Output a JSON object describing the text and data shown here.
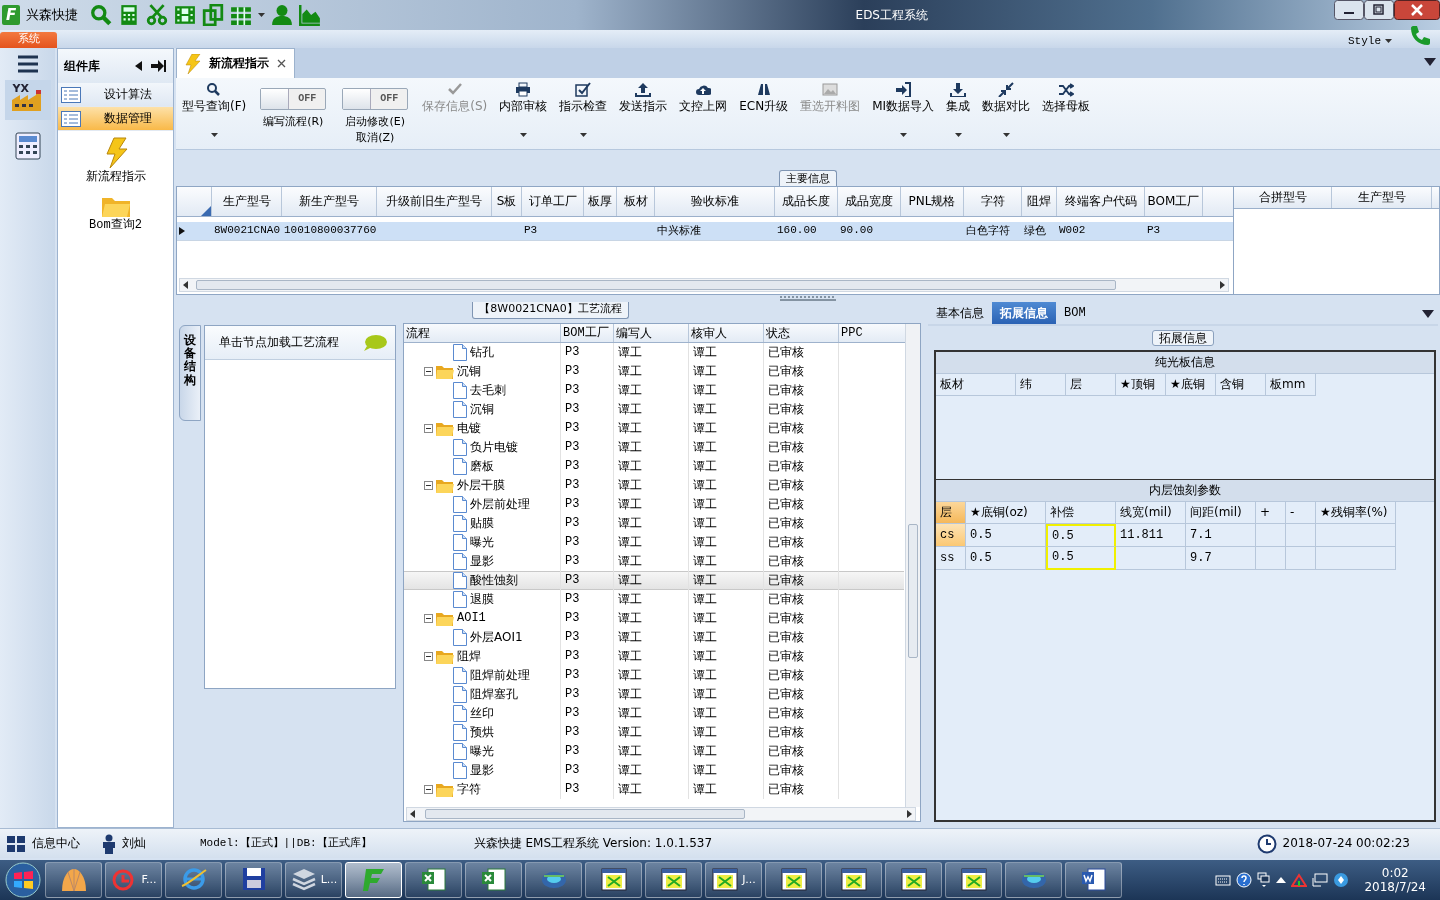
{
  "title_bar": {
    "logo": "F",
    "app_name": "兴森快捷",
    "title": "EDS工程系统"
  },
  "ribbon": {
    "tab": "系统",
    "style_menu": "Style"
  },
  "rail_items": [
    {
      "kind": "factory",
      "label": "YX",
      "selected": true
    },
    {
      "kind": "calculator",
      "selected": false
    }
  ],
  "component_panel": {
    "title": "组件库",
    "items": [
      {
        "label": "设计算法",
        "selected": false
      },
      {
        "label": "数据管理",
        "selected": true
      }
    ],
    "tools": [
      {
        "label": "新流程指示"
      },
      {
        "label": "Bom查询2"
      }
    ]
  },
  "document_tab": {
    "label": "新流程指示"
  },
  "toolbar": [
    {
      "kind": "button",
      "label": "型号查询(F)",
      "disabled": false,
      "dropdown": true
    },
    {
      "kind": "toggle",
      "toggle_text": "OFF",
      "on": false,
      "lines": [
        "编写流程(R)"
      ]
    },
    {
      "kind": "toggle",
      "toggle_text": "OFF",
      "on": false,
      "lines": [
        "启动修改(E)",
        "取消(Z)"
      ]
    },
    {
      "kind": "button",
      "label": "保存信息(S)",
      "disabled": true,
      "dropdown": false
    },
    {
      "kind": "button",
      "label": "内部审核",
      "disabled": false,
      "dropdown": true
    },
    {
      "kind": "button",
      "label": "指示检查",
      "disabled": false,
      "dropdown": true
    },
    {
      "kind": "button",
      "label": "发送指示",
      "disabled": false,
      "dropdown": false
    },
    {
      "kind": "button",
      "label": "文控上网",
      "disabled": false,
      "dropdown": false
    },
    {
      "kind": "button",
      "label": "ECN升级",
      "disabled": false,
      "dropdown": false
    },
    {
      "kind": "button",
      "label": "重选开料图",
      "disabled": true,
      "dropdown": false
    },
    {
      "kind": "button",
      "label": "MI数据导入",
      "disabled": false,
      "dropdown": true
    },
    {
      "kind": "button",
      "label": "集成",
      "disabled": false,
      "dropdown": true
    },
    {
      "kind": "button",
      "label": "数据对比",
      "disabled": false,
      "dropdown": true
    },
    {
      "kind": "button",
      "label": "选择母板",
      "disabled": false,
      "dropdown": false
    }
  ],
  "main_info": {
    "title": "主要信息",
    "columns": [
      "生产型号",
      "新生产型号",
      "升级前旧生产型号",
      "S板",
      "订单工厂",
      "板厚",
      "板材",
      "验收标准",
      "成品长度",
      "成品宽度",
      "PNL规格",
      "字符",
      "阻焊",
      "终端客户代码",
      "BOM工厂"
    ],
    "rows": [
      {
        "selected": true,
        "cells": [
          "8W0021CNA0",
          "10010800037760",
          null,
          null,
          "P3",
          null,
          null,
          "中兴标准",
          "160.00",
          "90.00",
          null,
          "白色字符",
          "绿色",
          "W002",
          "P3"
        ]
      }
    ],
    "side_columns": [
      "合拼型号",
      "生产型号"
    ]
  },
  "process": {
    "title": "【8W0021CNA0】工艺流程",
    "side_tab": "设备结构",
    "hint": "单击节点加载工艺流程",
    "columns": [
      "流程",
      "BOM工厂",
      "编写人",
      "核审人",
      "状态",
      "PPC"
    ],
    "tree": [
      {
        "children": [
          {
            "kind": "step",
            "label": "钻孔",
            "selected": false,
            "bom_factory": "P3",
            "writer": "谭工",
            "reviewer": "谭工",
            "status": "已审核"
          }
        ]
      },
      {
        "kind": "folder",
        "label": "沉铜",
        "expanded": true,
        "selected": false,
        "bom_factory": "P3",
        "writer": "谭工",
        "reviewer": "谭工",
        "status": "已审核",
        "children": [
          {
            "kind": "step",
            "label": "去毛刺",
            "selected": false,
            "bom_factory": "P3",
            "writer": "谭工",
            "reviewer": "谭工",
            "status": "已审核"
          },
          {
            "kind": "step",
            "label": "沉铜",
            "selected": false,
            "bom_factory": "P3",
            "writer": "谭工",
            "reviewer": "谭工",
            "status": "已审核"
          }
        ]
      },
      {
        "kind": "folder",
        "label": "电镀",
        "expanded": true,
        "selected": false,
        "bom_factory": "P3",
        "writer": "谭工",
        "reviewer": "谭工",
        "status": "已审核",
        "children": [
          {
            "kind": "step",
            "label": "负片电镀",
            "selected": false,
            "bom_factory": "P3",
            "writer": "谭工",
            "reviewer": "谭工",
            "status": "已审核"
          },
          {
            "kind": "step",
            "label": "磨板",
            "selected": false,
            "bom_factory": "P3",
            "writer": "谭工",
            "reviewer": "谭工",
            "status": "已审核"
          }
        ]
      },
      {
        "kind": "folder",
        "label": "外层干膜",
        "expanded": true,
        "selected": false,
        "bom_factory": "P3",
        "writer": "谭工",
        "reviewer": "谭工",
        "status": "已审核",
        "children": [
          {
            "kind": "step",
            "label": "外层前处理",
            "selected": false,
            "bom_factory": "P3",
            "writer": "谭工",
            "reviewer": "谭工",
            "status": "已审核"
          },
          {
            "kind": "step",
            "label": "贴膜",
            "selected": false,
            "bom_factory": "P3",
            "writer": "谭工",
            "reviewer": "谭工",
            "status": "已审核"
          },
          {
            "kind": "step",
            "label": "曝光",
            "selected": false,
            "bom_factory": "P3",
            "writer": "谭工",
            "reviewer": "谭工",
            "status": "已审核"
          },
          {
            "kind": "step",
            "label": "显影",
            "selected": false,
            "bom_factory": "P3",
            "writer": "谭工",
            "reviewer": "谭工",
            "status": "已审核"
          },
          {
            "kind": "step",
            "label": "酸性蚀刻",
            "selected": true,
            "bom_factory": "P3",
            "writer": "谭工",
            "reviewer": "谭工",
            "status": "已审核"
          },
          {
            "kind": "step",
            "label": "退膜",
            "selected": false,
            "bom_factory": "P3",
            "writer": "谭工",
            "reviewer": "谭工",
            "status": "已审核"
          }
        ]
      },
      {
        "kind": "folder",
        "label": "AOI1",
        "expanded": true,
        "selected": false,
        "bom_factory": "P3",
        "writer": "谭工",
        "reviewer": "谭工",
        "status": "已审核",
        "children": [
          {
            "kind": "step",
            "label": "外层AOI1",
            "selected": false,
            "bom_factory": "P3",
            "writer": "谭工",
            "reviewer": "谭工",
            "status": "已审核"
          }
        ]
      },
      {
        "kind": "folder",
        "label": "阻焊",
        "expanded": true,
        "selected": false,
        "bom_factory": "P3",
        "writer": "谭工",
        "reviewer": "谭工",
        "status": "已审核",
        "children": [
          {
            "kind": "step",
            "label": "阻焊前处理",
            "selected": false,
            "bom_factory": "P3",
            "writer": "谭工",
            "reviewer": "谭工",
            "status": "已审核"
          },
          {
            "kind": "step",
            "label": "阻焊塞孔",
            "selected": false,
            "bom_factory": "P3",
            "writer": "谭工",
            "reviewer": "谭工",
            "status": "已审核"
          },
          {
            "kind": "step",
            "label": "丝印",
            "selected": false,
            "bom_factory": "P3",
            "writer": "谭工",
            "reviewer": "谭工",
            "status": "已审核"
          },
          {
            "kind": "step",
            "label": "预烘",
            "selected": false,
            "bom_factory": "P3",
            "writer": "谭工",
            "reviewer": "谭工",
            "status": "已审核"
          },
          {
            "kind": "step",
            "label": "曝光",
            "selected": false,
            "bom_factory": "P3",
            "writer": "谭工",
            "reviewer": "谭工",
            "status": "已审核"
          },
          {
            "kind": "step",
            "label": "显影",
            "selected": false,
            "bom_factory": "P3",
            "writer": "谭工",
            "reviewer": "谭工",
            "status": "已审核"
          }
        ]
      },
      {
        "kind": "folder",
        "label": "字符",
        "expanded": true,
        "selected": false,
        "bom_factory": "P3",
        "writer": "谭工",
        "reviewer": "谭工",
        "status": "已审核"
      }
    ]
  },
  "detail": {
    "tabs": [
      {
        "label": "基本信息",
        "selected": false
      },
      {
        "label": "拓展信息",
        "selected": true
      },
      {
        "label": "BOM",
        "selected": false
      }
    ],
    "group_title": "拓展信息",
    "bare_board": {
      "title": "纯光板信息",
      "columns": [
        "板材",
        "纬",
        "层",
        "★顶铜",
        "★底铜",
        "含铜",
        "板mm"
      ]
    },
    "inner_etch": {
      "title": "内层蚀刻参数",
      "columns": [
        {
          "label": "层",
          "highlighted": false
        },
        {
          "label": "★底铜(oz)",
          "highlighted": false
        },
        {
          "label": "补偿",
          "highlighted": true
        },
        {
          "label": "线宽(mil)",
          "highlighted": false
        },
        {
          "label": "间距(mil)",
          "highlighted": false
        },
        {
          "label": "+",
          "highlighted": false
        },
        {
          "label": "-",
          "highlighted": false
        },
        {
          "label": "★残铜率(%)",
          "highlighted": false
        }
      ],
      "rows": [
        {
          "selected": true,
          "cells": [
            "cs",
            "0.5",
            "0.5",
            "11.811",
            "7.1",
            null,
            null,
            null
          ]
        },
        {
          "selected": false,
          "cells": [
            "ss",
            "0.5",
            "0.5",
            null,
            "9.7",
            null,
            null,
            null
          ]
        }
      ]
    }
  },
  "status_bar": {
    "info_center": "信息中心",
    "user": "刘灿",
    "model": "Model:【正式】||DB:【正式库】",
    "version": "兴森快捷 EMS工程系统 Version: 1.0.1.537",
    "datetime": "2018-07-24 00:02:23"
  },
  "taskbar": {
    "items": [
      {
        "kind": "shell",
        "selected": false
      },
      {
        "kind": "app",
        "label": "F...",
        "selected": false
      },
      {
        "kind": "browser",
        "selected": false
      },
      {
        "kind": "save",
        "selected": false
      },
      {
        "kind": "stack",
        "label": "L...",
        "selected": false
      },
      {
        "kind": "eds",
        "selected": true
      },
      {
        "kind": "excel",
        "selected": false
      },
      {
        "kind": "excel",
        "selected": false
      },
      {
        "kind": "globe",
        "selected": false
      },
      {
        "kind": "window",
        "selected": false
      },
      {
        "kind": "window",
        "selected": false
      },
      {
        "kind": "window",
        "label": "J...",
        "selected": false
      },
      {
        "kind": "window",
        "selected": false
      },
      {
        "kind": "window",
        "selected": false
      },
      {
        "kind": "window",
        "selected": false
      },
      {
        "kind": "window",
        "selected": false
      },
      {
        "kind": "globe",
        "selected": false
      },
      {
        "kind": "word",
        "selected": false
      }
    ],
    "time": "0:02",
    "date": "2018/7/24"
  }
}
